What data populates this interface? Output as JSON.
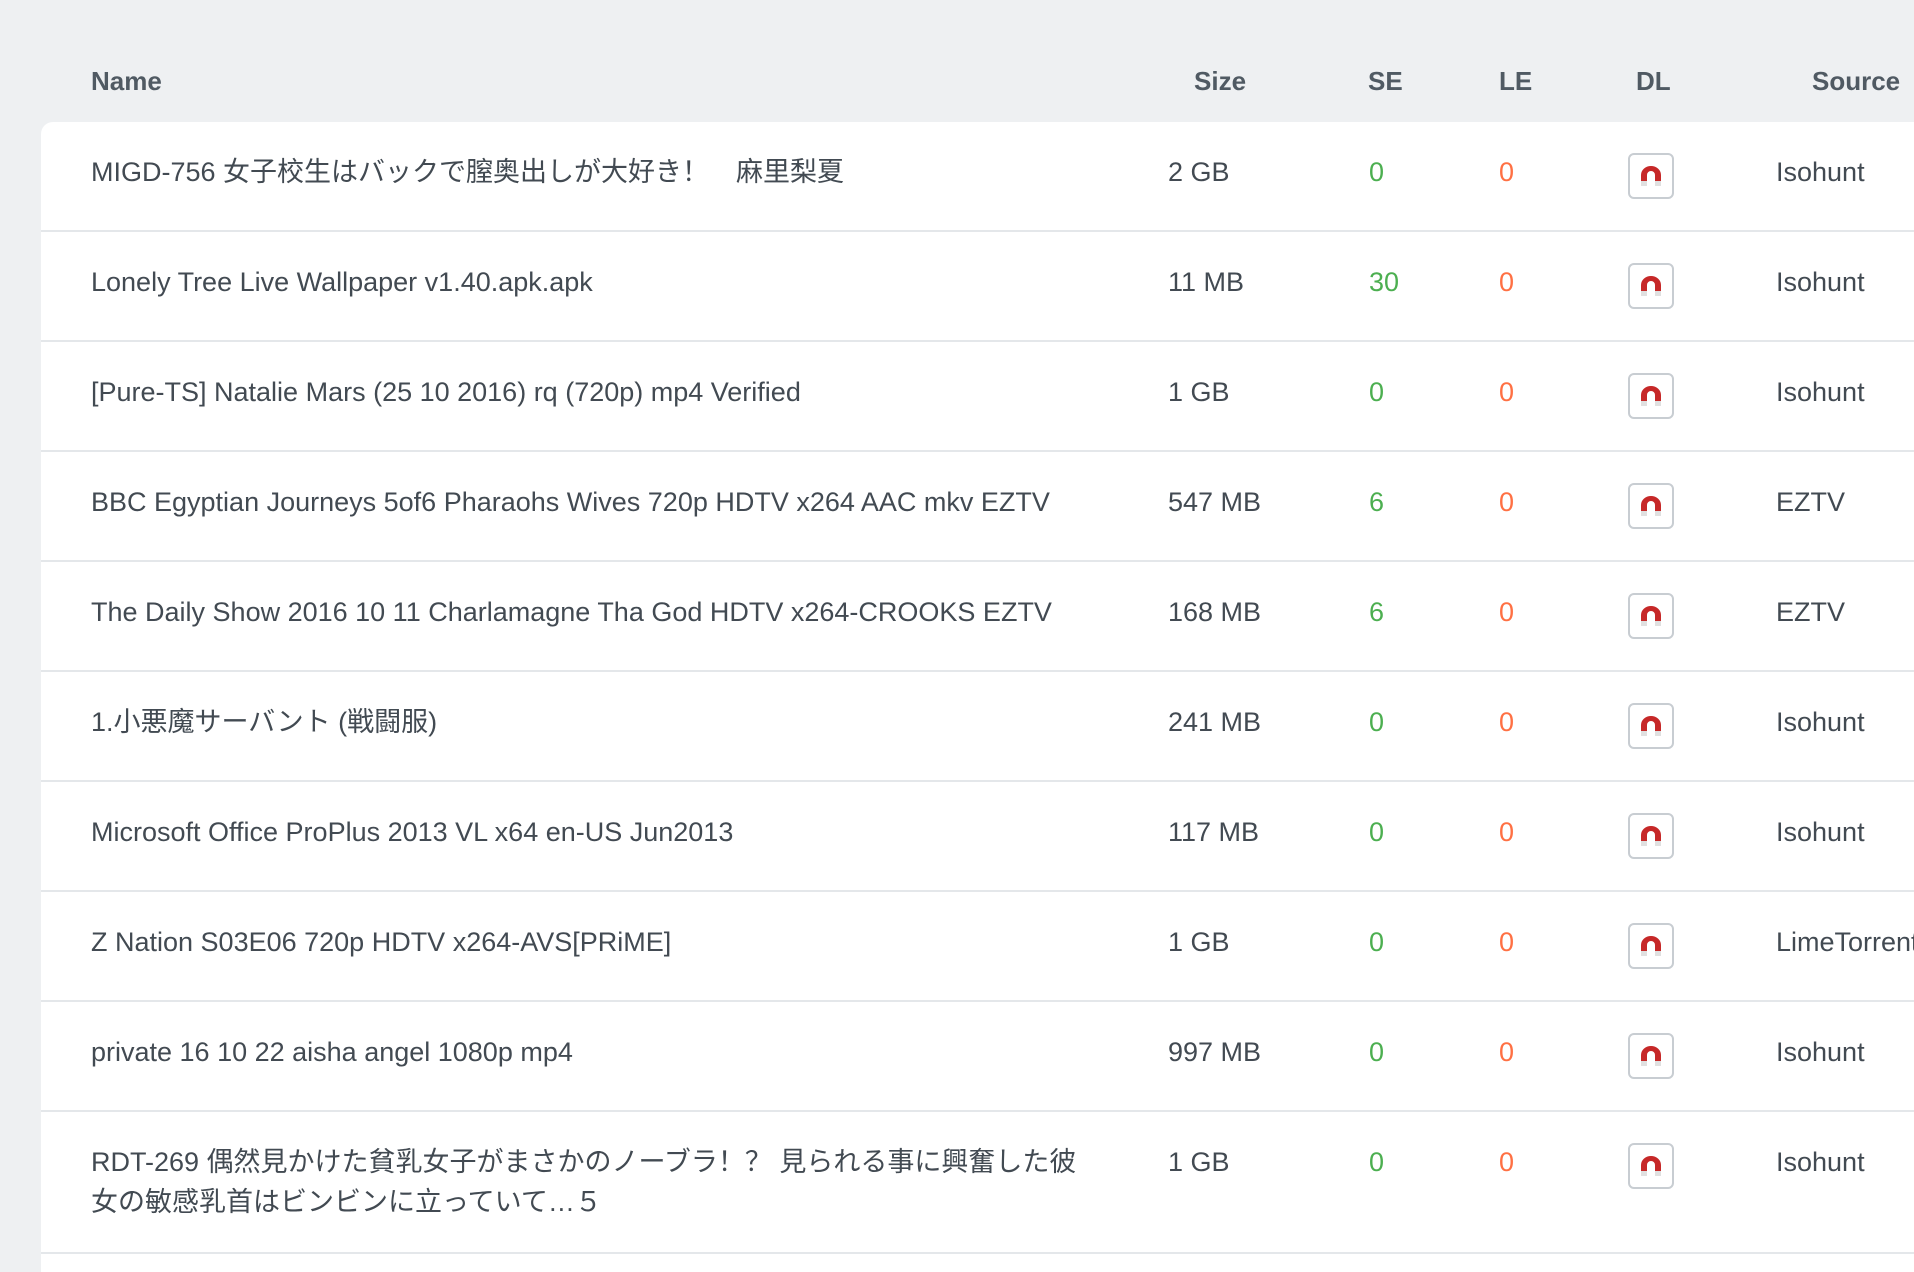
{
  "headers": {
    "name": "Name",
    "size": "Size",
    "se": "SE",
    "le": "LE",
    "dl": "DL",
    "source": "Source"
  },
  "colors": {
    "seeders": "#4caf50",
    "leechers": "#ff7043",
    "magnet": "#c62828"
  },
  "rows": [
    {
      "name": "MIGD-756 女子校生はバックで膣奥出しが大好き！　麻里梨夏",
      "size": "2 GB",
      "se": "0",
      "le": "0",
      "source": "Isohunt",
      "dl_icon": "magnet-icon"
    },
    {
      "name": "Lonely Tree Live Wallpaper v1.40.apk.apk",
      "size": "11 MB",
      "se": "30",
      "le": "0",
      "source": "Isohunt",
      "dl_icon": "magnet-icon"
    },
    {
      "name": "[Pure-TS] Natalie Mars (25 10 2016) rq (720p) mp4 Verified",
      "size": "1 GB",
      "se": "0",
      "le": "0",
      "source": "Isohunt",
      "dl_icon": "magnet-icon"
    },
    {
      "name": "BBC Egyptian Journeys 5of6 Pharaohs Wives 720p HDTV x264 AAC mkv EZTV",
      "size": "547 MB",
      "se": "6",
      "le": "0",
      "source": "EZTV",
      "dl_icon": "magnet-icon"
    },
    {
      "name": "The Daily Show 2016 10 11 Charlamagne Tha God HDTV x264-CROOKS EZTV",
      "size": "168 MB",
      "se": "6",
      "le": "0",
      "source": "EZTV",
      "dl_icon": "magnet-icon"
    },
    {
      "name": "1.小悪魔サーバント (戦闘服)",
      "size": "241 MB",
      "se": "0",
      "le": "0",
      "source": "Isohunt",
      "dl_icon": "magnet-icon"
    },
    {
      "name": "Microsoft Office ProPlus 2013 VL x64 en-US Jun2013",
      "size": "117 MB",
      "se": "0",
      "le": "0",
      "source": "Isohunt",
      "dl_icon": "magnet-icon"
    },
    {
      "name": "Z Nation S03E06 720p HDTV x264-AVS[PRiME]",
      "size": "1 GB",
      "se": "0",
      "le": "0",
      "source": "LimeTorrents",
      "dl_icon": "magnet-icon"
    },
    {
      "name": "private 16 10 22 aisha angel 1080p mp4",
      "size": "997 MB",
      "se": "0",
      "le": "0",
      "source": "Isohunt",
      "dl_icon": "magnet-icon"
    },
    {
      "name": "RDT-269 偶然見かけた貧乳女子がまさかのノーブラ！？ 見られる事に興奮した彼女の敏感乳首はビンビンに立っていて…５",
      "size": "1 GB",
      "se": "0",
      "le": "0",
      "source": "Isohunt",
      "dl_icon": "magnet-icon"
    }
  ]
}
